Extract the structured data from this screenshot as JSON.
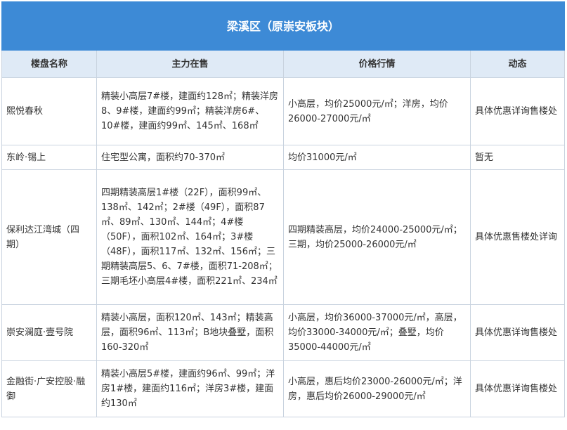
{
  "title": "梁溪区（原崇安板块）",
  "headers": [
    "楼盘名称",
    "主力在售",
    "价格行情",
    "动态"
  ],
  "rows": [
    {
      "name": "熙悦春秋",
      "sale": "精装小高层7#楼，建面约128㎡；精装洋房8、9#楼，建面约99㎡；精装洋房6#、10#楼，建面约99㎡、145㎡、168㎡",
      "price": "小高层，均价25000元/㎡；洋房，均价26000-27000元/㎡",
      "status": "具体优惠详询售楼处"
    },
    {
      "name": "东岭·锡上",
      "sale": "住宅型公寓，面积约70-370㎡",
      "price": "均价31000元/㎡",
      "status": "暂无"
    },
    {
      "name": "保利达江湾城（四期）",
      "sale": "四期精装高层1#楼（22F），面积99㎡、138㎡、142㎡；2#楼（49F），面积87㎡、89㎡、130㎡、144㎡；4#楼（50F），面积102㎡、164㎡；3#楼（48F），面积117㎡、132㎡、156㎡；三期精装高层5、6、7#楼，面积71-208㎡；三期毛坯小高层4#楼，面积221㎡、234㎡",
      "price": "四期精装高层，均价24000-25000元/㎡；三期，均价25000-26000元/㎡",
      "status": "具体优惠售楼处详询"
    },
    {
      "name": "崇安澜庭·壹号院",
      "sale": "精装小高层，面积120㎡、143㎡；精装高层，面积96㎡、113㎡；B地块叠墅，面积160-320㎡",
      "price": "小高层，均价36000-37000元/㎡，高层，均价33000-34000元/㎡；叠墅，均价35000-44000元/㎡",
      "status": "具体优惠详询售楼处"
    },
    {
      "name": "金融街·广安控股·融御",
      "sale": "精装小高层5#楼，建面约96㎡、99㎡；洋房1#楼，建面约116㎡；洋房3#楼，建面约130㎡",
      "price": "小高层，惠后均价23000-26000元/㎡；洋房，惠后均价26000-29000元/㎡",
      "status": "具体优惠详询售楼处"
    }
  ]
}
